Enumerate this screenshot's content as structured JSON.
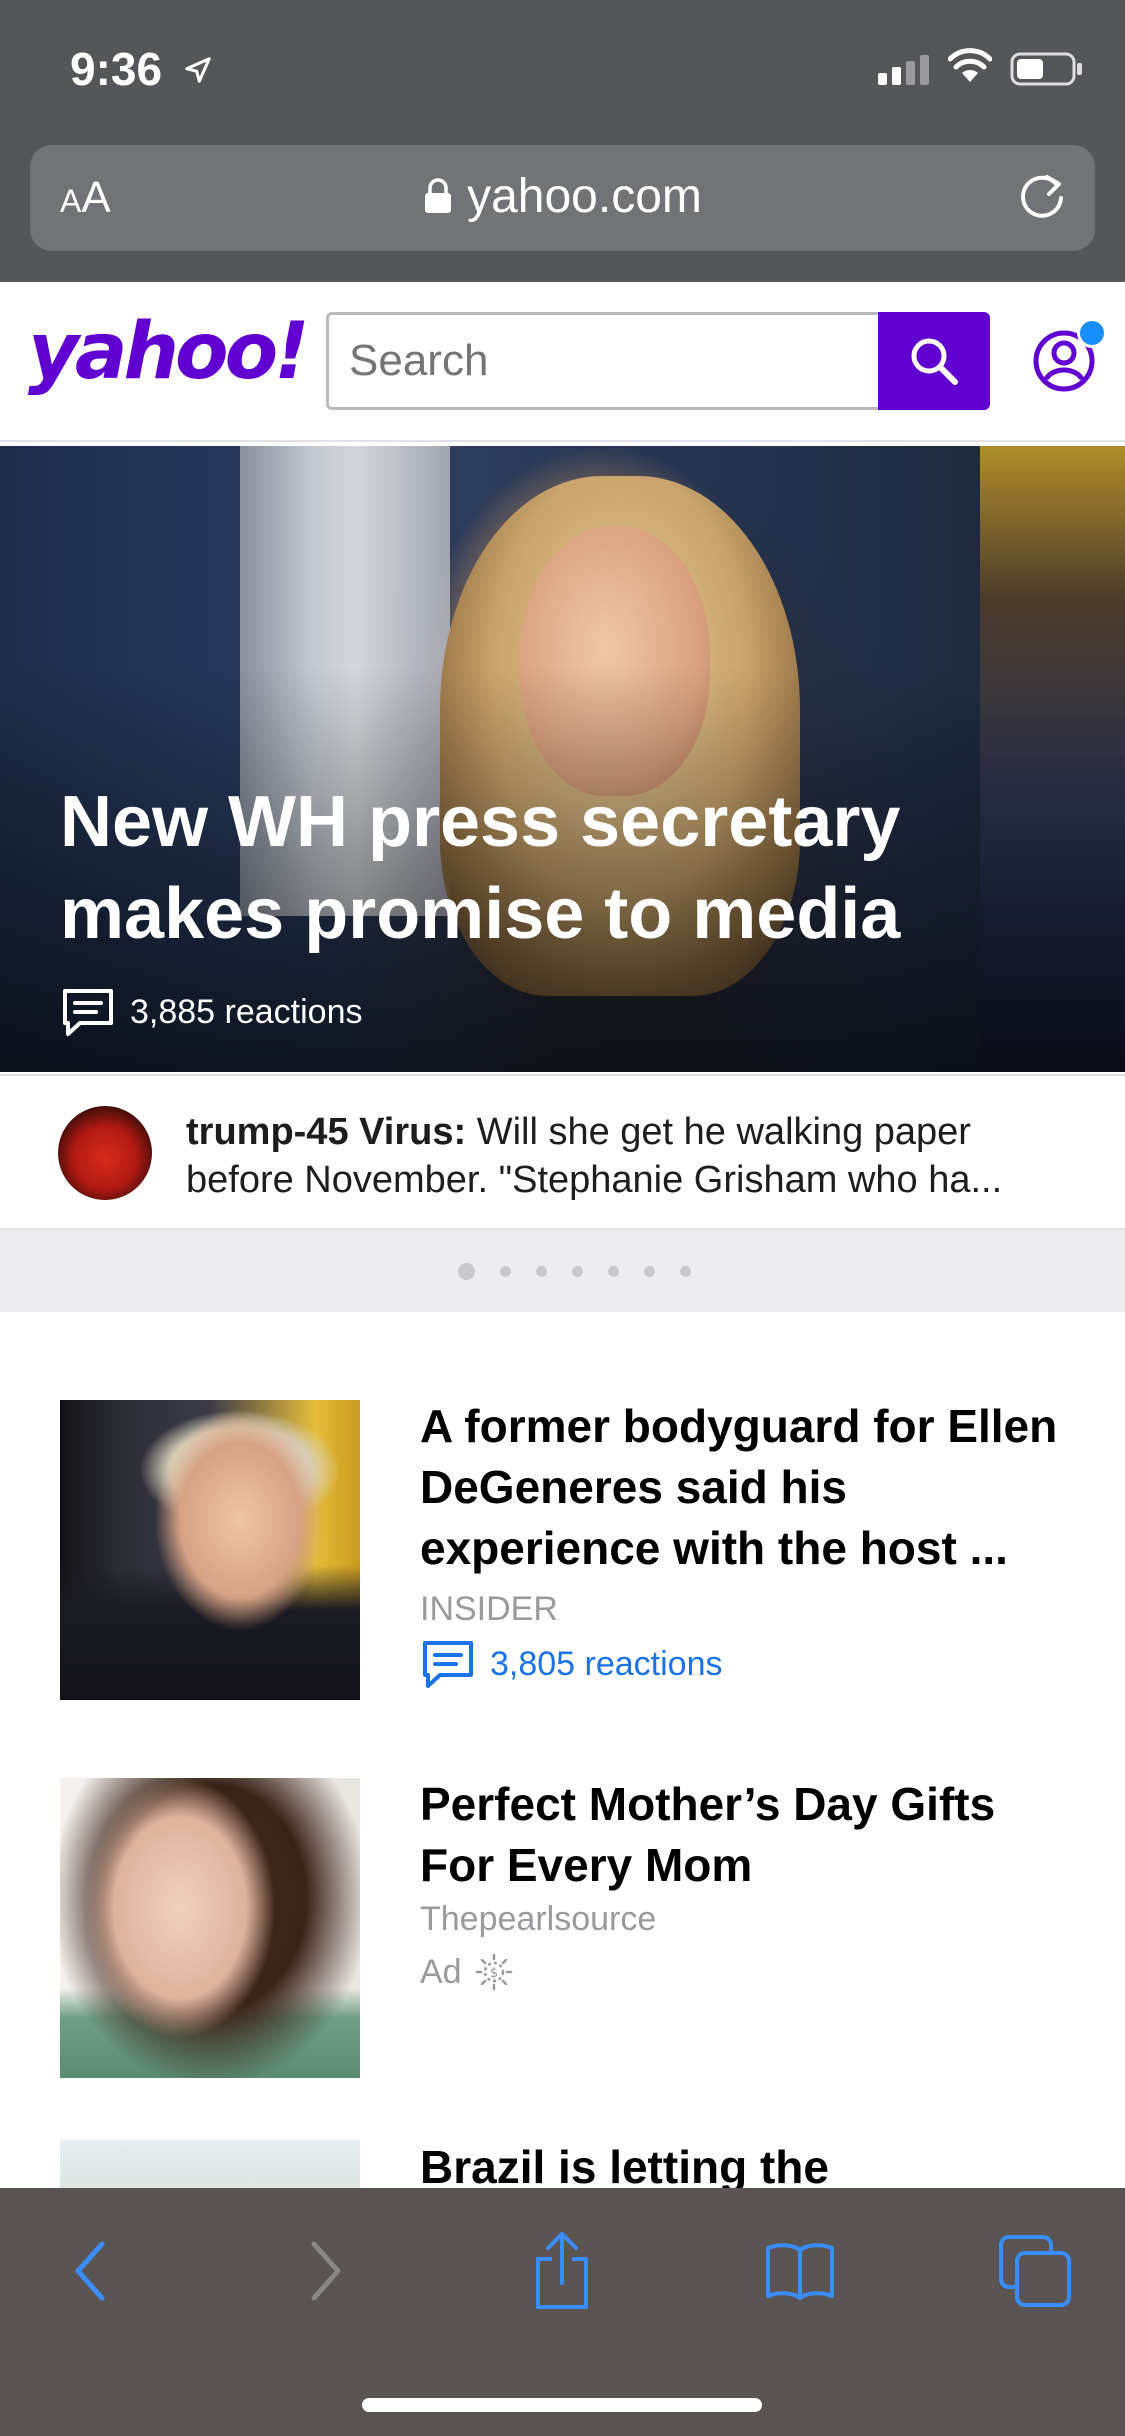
{
  "status_bar": {
    "time": "9:36",
    "location_arrow": "location-arrow-icon",
    "signal": "signal-bars-icon",
    "wifi": "wifi-icon",
    "battery": "battery-icon"
  },
  "browser": {
    "text_size_label": "AA",
    "domain": "yahoo.com",
    "lock_icon": "lock-icon",
    "reload_icon": "reload-icon"
  },
  "header": {
    "logo_text": "yahoo!",
    "search_placeholder": "Search",
    "colors": {
      "brand": "#6001d2",
      "notification": "#188fff"
    }
  },
  "hero": {
    "title": "New WH press secretary makes promise to media",
    "reactions": "3,885 reactions"
  },
  "top_comment": {
    "author": "trump-45 Virus:",
    "text": "Will she get he walking paper before November. \"Stephanie Grisham who ha..."
  },
  "carousel": {
    "total_dots": 7,
    "active_index": 0
  },
  "stories": [
    {
      "title": "A former bodyguard for Ellen DeGeneres said his experience with the host ...",
      "source": "INSIDER",
      "reactions": "3,805 reactions"
    },
    {
      "title": "Perfect Mother’s Day Gifts For Every Mom",
      "source": "Thepearlsource",
      "ad_label": "Ad"
    },
    {
      "title": "Brazil is letting the"
    }
  ],
  "toolbar": {
    "back": "back-icon",
    "forward": "forward-icon",
    "share": "share-icon",
    "bookmarks": "bookmarks-icon",
    "tabs": "tabs-icon",
    "colors": {
      "active": "#3a8dff",
      "disabled": "#8a8684"
    }
  }
}
